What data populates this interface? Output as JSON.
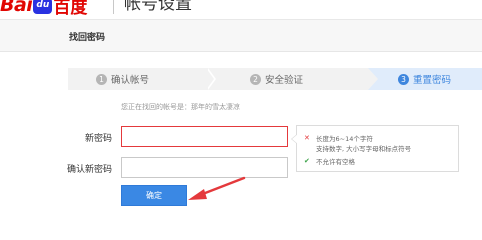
{
  "header": {
    "logo": {
      "part1": "Bai",
      "paw_text": "du",
      "part2": "百度"
    },
    "title": "帐号设置"
  },
  "subbar": {
    "title": "找回密码"
  },
  "steps": [
    {
      "num": "1",
      "label": "确认帐号"
    },
    {
      "num": "2",
      "label": "安全验证"
    },
    {
      "num": "3",
      "label": "重置密码"
    }
  ],
  "hint": "您正在找回的帐号是：那年的雪太凄凉",
  "form": {
    "new_password_label": "新密码",
    "confirm_password_label": "确认新密码",
    "new_password_value": "",
    "confirm_password_value": "",
    "submit_label": "确定"
  },
  "tips": {
    "length_rule": "长度为6~14个字符",
    "charset_rule": "支持数字, 大小写字母和标点符号",
    "space_rule": "不允许有空格",
    "icons": [
      "cross-icon",
      "check-icon"
    ],
    "colors": {
      "error": "#e4393c",
      "ok": "#3da34a"
    }
  },
  "colors": {
    "accent": "#3a88e4",
    "brand_red": "#e10602",
    "annotation_arrow": "#e4393c"
  }
}
